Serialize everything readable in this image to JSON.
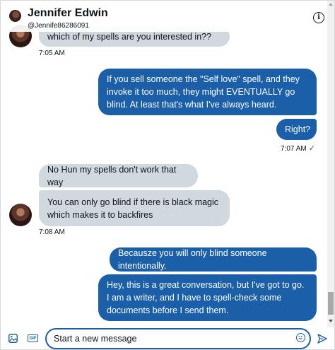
{
  "header": {
    "name": "Jennifer Edwin",
    "handle": "@Jennife86286091",
    "info_icon": "info-icon"
  },
  "messages": [
    {
      "side": "received",
      "text": "which of my spells are you interested in??"
    },
    {
      "side": "received_time",
      "text": "7:05 AM"
    },
    {
      "side": "sent",
      "text": "If you sell someone the \"Self love\" spell, and they invoke it too much, they might EVENTUALLY go blind. At least that's what I've always heard."
    },
    {
      "side": "sent",
      "text": "Right?"
    },
    {
      "side": "sent_time",
      "text": "7:07 AM",
      "status": "✓"
    },
    {
      "side": "received",
      "text": "No Hun my spells don't work that way"
    },
    {
      "side": "received",
      "text": "You can only go blind if there is black magic which makes it to backfires"
    },
    {
      "side": "received_time",
      "text": "7:08 AM"
    },
    {
      "side": "sent",
      "text": "Becausze you will only blind someone intentionally."
    },
    {
      "side": "sent",
      "text": "Hey, this is a great conversation, but I've got to go.  I am a writer, and I have to spell-check some documents before I send them."
    }
  ],
  "composer": {
    "placeholder": "Start a new message",
    "media_icon": "image-icon",
    "gif_label": "GIF",
    "emoji_icon": "emoji-icon",
    "send_icon": "send-icon"
  },
  "colors": {
    "accent": "#1a5fa8",
    "received_bubble": "#cfd9de"
  }
}
